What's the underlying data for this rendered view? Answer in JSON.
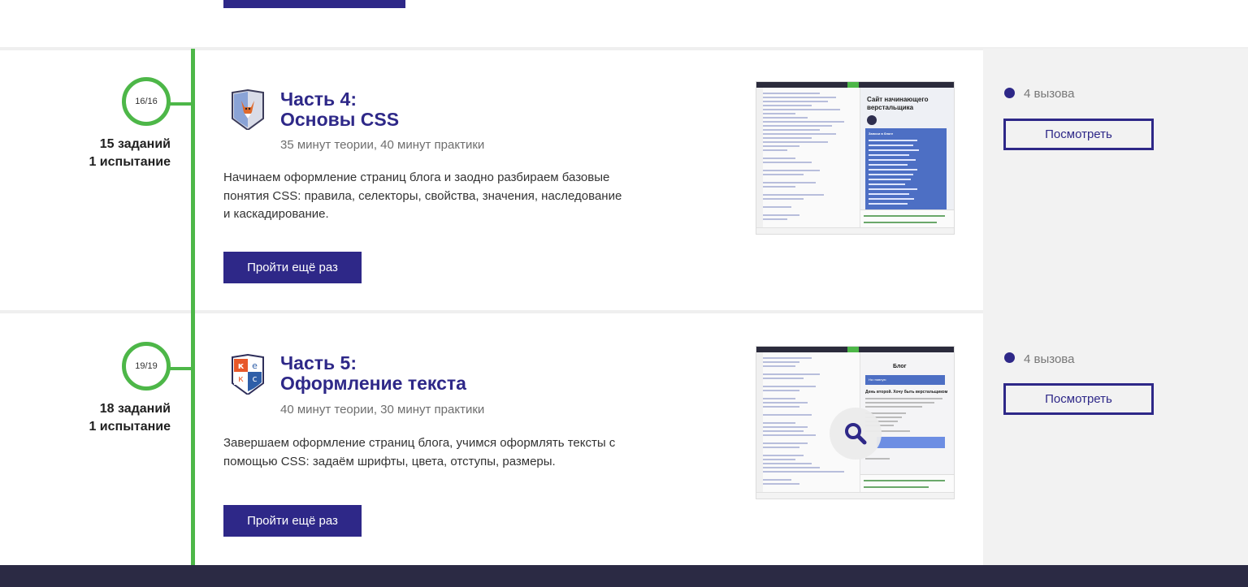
{
  "modules": [
    {
      "counter": "16/16",
      "tasks": "15 заданий",
      "trials": "1 испытание",
      "title_line1": "Часть 4:",
      "title_line2": "Основы CSS",
      "duration": "35 минут теории, 40 минут практики",
      "description": "Начинаем оформление страниц блога и заодно разбираем базовые понятия CSS: правила, селекторы, свойства, значения, наследование и каскадирование.",
      "retry_label": "Пройти ещё раз",
      "preview_title": "Сайт начинающего верстальщика",
      "preview_box_heading": "Записи в блоге",
      "challenges": "4 вызова",
      "view_label": "Посмотреть"
    },
    {
      "counter": "19/19",
      "tasks": "18 заданий",
      "trials": "1 испытание",
      "title_line1": "Часть 5:",
      "title_line2": "Оформление текста",
      "duration": "40 минут теории, 30 минут практики",
      "description": "Завершаем оформление страниц блога, учимся оформлять тексты с помощью CSS: задаём шрифты, цвета, отступы, размеры.",
      "retry_label": "Пройти ещё раз",
      "preview_title": "Блог",
      "preview_nav": "На главную",
      "preview_heading": "День второй. Хочу быть верстальщиком",
      "challenges": "4 вызова",
      "view_label": "Посмотреть"
    }
  ],
  "badges": {
    "part4": {
      "icon": "fox-shield-icon"
    },
    "part5": {
      "icon": "kecs-shield-icon",
      "letters": [
        "к",
        "е",
        "к",
        "с"
      ]
    }
  },
  "colors": {
    "accent": "#2e2888",
    "timeline": "#4db748",
    "panel": "#f2f2f2",
    "footer": "#2b2a44"
  }
}
